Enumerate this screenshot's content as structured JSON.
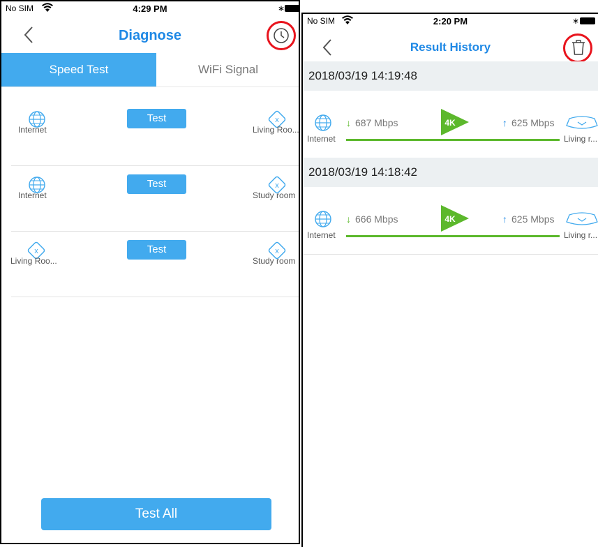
{
  "left_screen": {
    "status": {
      "carrier": "No SIM",
      "time": "4:29 PM"
    },
    "title": "Diagnose",
    "tabs": [
      {
        "label": "Speed Test",
        "active": true
      },
      {
        "label": "WiFi Signal",
        "active": false
      }
    ],
    "rows": [
      {
        "from": "Internet",
        "from_icon": "globe-icon",
        "button": "Test",
        "to": "Living Roo...",
        "to_icon": "router-icon"
      },
      {
        "from": "Internet",
        "from_icon": "globe-icon",
        "button": "Test",
        "to": "Study room",
        "to_icon": "router-icon"
      },
      {
        "from": "Living Roo...",
        "from_icon": "router-icon",
        "button": "Test",
        "to": "Study room",
        "to_icon": "router-icon"
      }
    ],
    "test_all_label": "Test All"
  },
  "right_screen": {
    "status": {
      "carrier": "No SIM",
      "time": "2:20 PM"
    },
    "title": "Result History",
    "results": [
      {
        "timestamp": "2018/03/19 14:19:48",
        "download": "687 Mbps",
        "upload": "625 Mbps",
        "badge": "4K",
        "from": "Internet",
        "to": "Living r..."
      },
      {
        "timestamp": "2018/03/19 14:18:42",
        "download": "666 Mbps",
        "upload": "625 Mbps",
        "badge": "4K",
        "from": "Internet",
        "to": "Living r..."
      }
    ]
  },
  "colors": {
    "accent": "#42aaee",
    "title_blue": "#1e88e5",
    "green": "#5cb82c",
    "highlight_red": "#e8141d"
  }
}
